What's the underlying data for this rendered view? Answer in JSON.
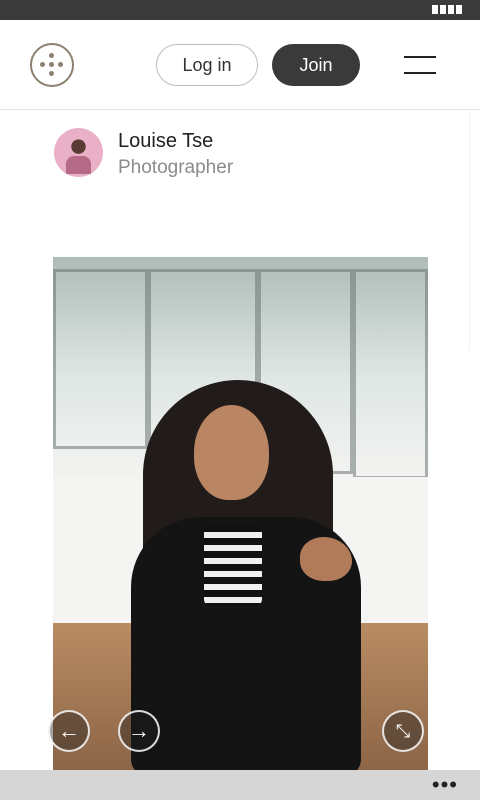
{
  "status_bar": {
    "battery_icon": "battery-icon"
  },
  "header": {
    "logo_icon": "dot-flower-logo-icon",
    "login_label": "Log in",
    "join_label": "Join",
    "menu_icon": "hamburger-menu-icon"
  },
  "profile": {
    "name": "Louise Tse",
    "role": "Photographer",
    "avatar_icon": "profile-avatar"
  },
  "gallery": {
    "image_icon": "portrait-photo",
    "prev_icon": "←",
    "next_icon": "→",
    "fullscreen_icon": "⤡"
  },
  "bottom_bar": {
    "more_icon": "•••"
  },
  "colors": {
    "status_bar": "#3b3b3b",
    "join_button": "#3a3a3a",
    "logo": "#8c8070",
    "bottom_bar": "#d6d6d6"
  }
}
